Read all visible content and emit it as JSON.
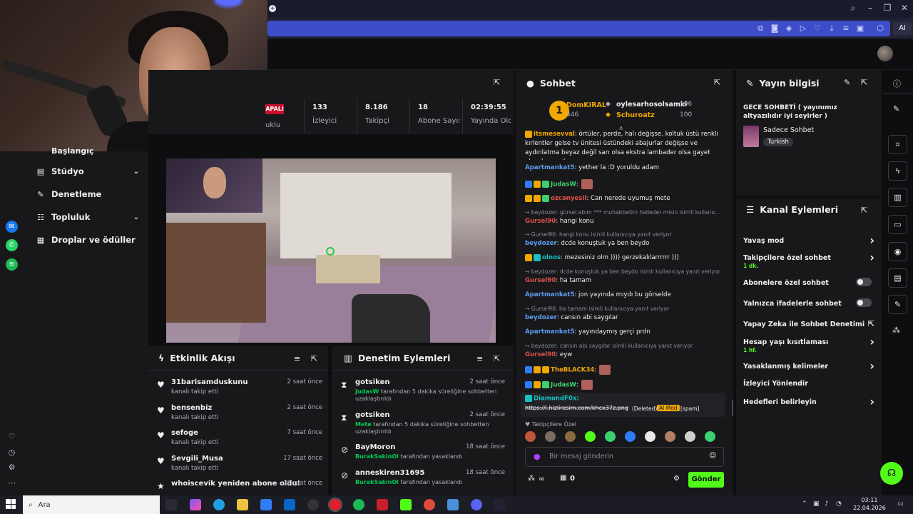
{
  "browser": {
    "ai_label": "AI"
  },
  "webcam": {
    "label": "Webcam overlay"
  },
  "sidebar": {
    "partial_label": "Başlangıç",
    "items": [
      {
        "label": "Stüdyo",
        "icon": "film-icon",
        "has_chevron": true
      },
      {
        "label": "Denetleme",
        "icon": "wrench-icon",
        "has_chevron": false
      },
      {
        "label": "Topluluk",
        "icon": "users-icon",
        "has_chevron": true
      },
      {
        "label": "Droplar ve ödüller",
        "icon": "gift-icon",
        "has_chevron": false
      }
    ]
  },
  "stats": {
    "status_badge": "APALI",
    "status_partial": "uklu",
    "items": [
      {
        "value": "133",
        "label": "İzleyici"
      },
      {
        "value": "8.186",
        "label": "Takipçi"
      },
      {
        "value": "18",
        "label": "Abone Sayısı"
      },
      {
        "value": "02:39:55",
        "label": "Yayında Olduğu"
      }
    ]
  },
  "activity": {
    "title": "Etkinlik Akışı",
    "items": [
      {
        "name": "31barisamduskunu",
        "sub": "kanalı takip etti",
        "time": "2 saat önce"
      },
      {
        "name": "bensenbiz",
        "sub": "kanalı takip etti",
        "time": "2 saat önce"
      },
      {
        "name": "sefoge",
        "sub": "kanalı takip etti",
        "time": "7 saat önce"
      },
      {
        "name": "Sevgili_Musa",
        "sub": "kanalı takip etti",
        "time": "17 saat önce"
      },
      {
        "name": "whoiscevik yeniden abone oldu!",
        "sub": "",
        "time": "18 saat önce"
      }
    ]
  },
  "modlog": {
    "title": "Denetim Eylemleri",
    "items": [
      {
        "name": "gotsiken",
        "actor": "JudasW",
        "sub": " tarafından 5 dakika süreliğine sohbetten uzaklaştırıldı",
        "time": "2 saat önce",
        "icon": "hourglass-icon"
      },
      {
        "name": "gotsiken",
        "actor": "Mete",
        "sub": " tarafından 5 dakika süreliğine sohbetten uzaklaştırıldı",
        "time": "2 saat önce",
        "icon": "hourglass-icon"
      },
      {
        "name": "BayMoron",
        "actor": "BurakSakinOl",
        "sub": " tarafından yasaklandı",
        "time": "18 saat önce",
        "icon": "ban-icon"
      },
      {
        "name": "anneskiren31695",
        "actor": "BurakSakinOl",
        "sub": " tarafından yasaklandı",
        "time": "18 saat önce",
        "icon": "ban-icon"
      }
    ]
  },
  "chat": {
    "title": "Sohbet",
    "leader": {
      "rank": "1",
      "name": "DomKIRAL",
      "score": "446"
    },
    "top": [
      {
        "name": "oylesarhosolsamki",
        "score": "106"
      },
      {
        "name": "Schuroatz",
        "score": "100"
      }
    ],
    "lines": [
      {
        "type": "msg",
        "user": "itsmesevval",
        "color": "#f0a800",
        "text": ": örtüler, perde, halı değişse. koltuk üstü renkli kırlentler gelse tv ünitesi üstündeki abajurlar değişse ve aydınlatma beyaz değil sarı olsa ekstra lambader olsa gayet okey bu arada"
      },
      {
        "type": "msg",
        "user": "Apartmankat5",
        "color": "#5c9ded",
        "text": ": yether la :D yoruldu adam"
      },
      {
        "type": "msg",
        "user": "JudasW",
        "color": "#3bd16f",
        "text": ":"
      },
      {
        "type": "msg",
        "user": "ozcanyesil",
        "color": "#e0504a",
        "text": ": Can nerede uyumuş mete"
      },
      {
        "type": "reply",
        "text": "beydozer: gürsel abim *** muhabbetini halleder misin isimli kullanıc..."
      },
      {
        "type": "msg",
        "user": "Gursel90",
        "color": "#e0504a",
        "text": ": hangi konu"
      },
      {
        "type": "reply",
        "text": "Gursel90: hangi konu isimli kullanıcıya yanıt veriyor"
      },
      {
        "type": "msg",
        "user": "beydozer",
        "color": "#5c9ded",
        "text": ": dcde konuştuk ya ben beydo"
      },
      {
        "type": "msg",
        "user": "olnos",
        "color": "#16c0c0",
        "text": ": mezesiniz olm )))) gerzekalılarrrrrr )))"
      },
      {
        "type": "reply",
        "text": "beydozer: dcde konuştuk ya ben beydo isimli kullanıcıya yanıt veriyor"
      },
      {
        "type": "msg",
        "user": "Gursel90",
        "color": "#e0504a",
        "text": ": ha tamam"
      },
      {
        "type": "msg",
        "user": "Apartmankat5",
        "color": "#5c9ded",
        "text": ": jon yayında mıydı bu görselde"
      },
      {
        "type": "reply",
        "text": "Gursel90: ha tamam isimli kullanıcıya yanıt veriyor"
      },
      {
        "type": "msg",
        "user": "beydozer",
        "color": "#5c9ded",
        "text": ": cansın abi saygılar"
      },
      {
        "type": "msg",
        "user": "Apartmankat5",
        "color": "#5c9ded",
        "text": ": yayındaymış gerçi prdn"
      },
      {
        "type": "reply",
        "text": "beydozer: cansın abi saygılar isimli kullanıcıya yanıt veriyor"
      },
      {
        "type": "msg",
        "user": "Gursel90",
        "color": "#e0504a",
        "text": ": eyw"
      },
      {
        "type": "msg",
        "user": "TheBLACK34",
        "color": "#f0a800",
        "text": ":"
      },
      {
        "type": "msg",
        "user": "JudasW",
        "color": "#3bd16f",
        "text": ":"
      },
      {
        "type": "msg",
        "user": "DiamondF0x",
        "color": "#16c0c0",
        "text": ":"
      }
    ],
    "deleted_link": "https://i.hizliresim.com/khcx37z.png",
    "deleted_tag": "(Deleted)",
    "aimod_tag": "AI Mod",
    "spam_tag": "[spam]",
    "followers_only": "Takipçilere Özel",
    "input_placeholder": "Bir mesaj gönderin",
    "points": "0",
    "infinity": "∞",
    "send": "Gönder"
  },
  "info": {
    "title": "Yayın bilgisi",
    "stream_title": "GECE SOHBETİ ( yayınımız altyazılıdır iyi seyirler )",
    "category": "Sadece Sohbet",
    "tag": "Turkish"
  },
  "actions": {
    "title": "Kanal Eylemleri",
    "rows": [
      {
        "label": "Yavaş mod",
        "sub": "",
        "control": "chevron"
      },
      {
        "label": "Takipçilere özel sohbet",
        "sub": "1 dk.",
        "control": "chevron"
      },
      {
        "label": "Abonelere özel sohbet",
        "sub": "",
        "control": "toggle"
      },
      {
        "label": "Yalnızca ifadelerle sohbet",
        "sub": "",
        "control": "toggle"
      },
      {
        "label": "Yapay Zeka ile Sohbet Denetimi",
        "sub": "",
        "control": "external"
      },
      {
        "label": "Hesap yaşı kısıtlaması",
        "sub": "1 hf.",
        "control": "chevron"
      },
      {
        "label": "Yasaklanmış kelimeler",
        "sub": "",
        "control": "chevron"
      },
      {
        "label": "İzleyici Yönlendir",
        "sub": "",
        "control": "none"
      },
      {
        "label": "Hedefleri belirleyin",
        "sub": "",
        "control": "chevron"
      }
    ]
  },
  "taskbar": {
    "search": "Ara",
    "time": "03:11",
    "date": "22.04.2026"
  },
  "colors": {
    "accent": "#53fc18",
    "bg": "#0e0e10",
    "panel": "#18181b"
  }
}
